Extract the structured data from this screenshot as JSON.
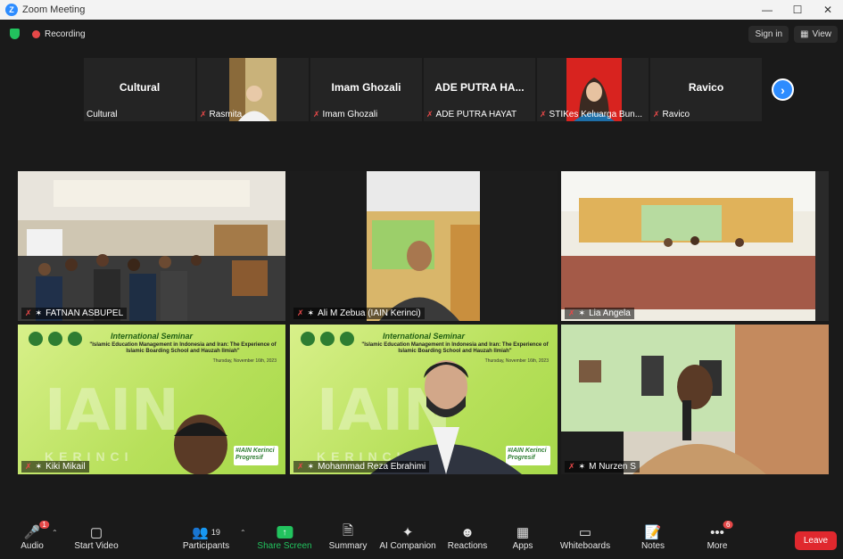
{
  "window": {
    "title": "Zoom Meeting",
    "logo_letter": "Z"
  },
  "topbar": {
    "recording_label": "Recording",
    "sign_in_label": "Sign in",
    "view_label": "View"
  },
  "strip": [
    {
      "label": "Cultural",
      "big": "Cultural",
      "has_video": false,
      "muted": false
    },
    {
      "label": "Rasmita",
      "big": "",
      "has_video": true,
      "muted": true
    },
    {
      "label": "Imam Ghozali",
      "big": "Imam Ghozali",
      "has_video": false,
      "muted": true
    },
    {
      "label": "ADE PUTRA HAYAT",
      "big": "ADE PUTRA HA...",
      "has_video": false,
      "muted": true
    },
    {
      "label": "STIKes Keluarga Bun...",
      "big": "",
      "has_video": true,
      "muted": true
    },
    {
      "label": "Ravico",
      "big": "Ravico",
      "has_video": false,
      "muted": true
    }
  ],
  "tiles": [
    {
      "name": "FATNAN ASBUPEL"
    },
    {
      "name": "Ali M Zebua (IAIN Kerinci)"
    },
    {
      "name": "Lia Angela"
    },
    {
      "name": "Kiki Mikail"
    },
    {
      "name": "Mohammad Reza Ebrahimi"
    },
    {
      "name": "M Nurzen S"
    }
  ],
  "seminar": {
    "title": "International Seminar",
    "subtitle": "\"Islamic Education Management in Indonesia and Iran: The Experience of Islamic Boarding School and Hauzah Ilmiah\"",
    "date": "Thursday, November 16th, 2023",
    "iain": "IAIN",
    "kerinci": "KERINCI",
    "progressive_tag": "#IAIN Kerinci Progresif"
  },
  "toolbar": {
    "audio": "Audio",
    "audio_badge": "1",
    "start_video": "Start Video",
    "participants": "Participants",
    "participants_count": "19",
    "share_screen": "Share Screen",
    "summary": "Summary",
    "ai_companion": "AI Companion",
    "reactions": "Reactions",
    "apps": "Apps",
    "whiteboards": "Whiteboards",
    "notes": "Notes",
    "more": "More",
    "more_badge": "6",
    "leave": "Leave"
  },
  "colors": {
    "accent": "#2d8cff",
    "green": "#22c35e",
    "red": "#e0282e",
    "background": "#1a1a1a"
  }
}
